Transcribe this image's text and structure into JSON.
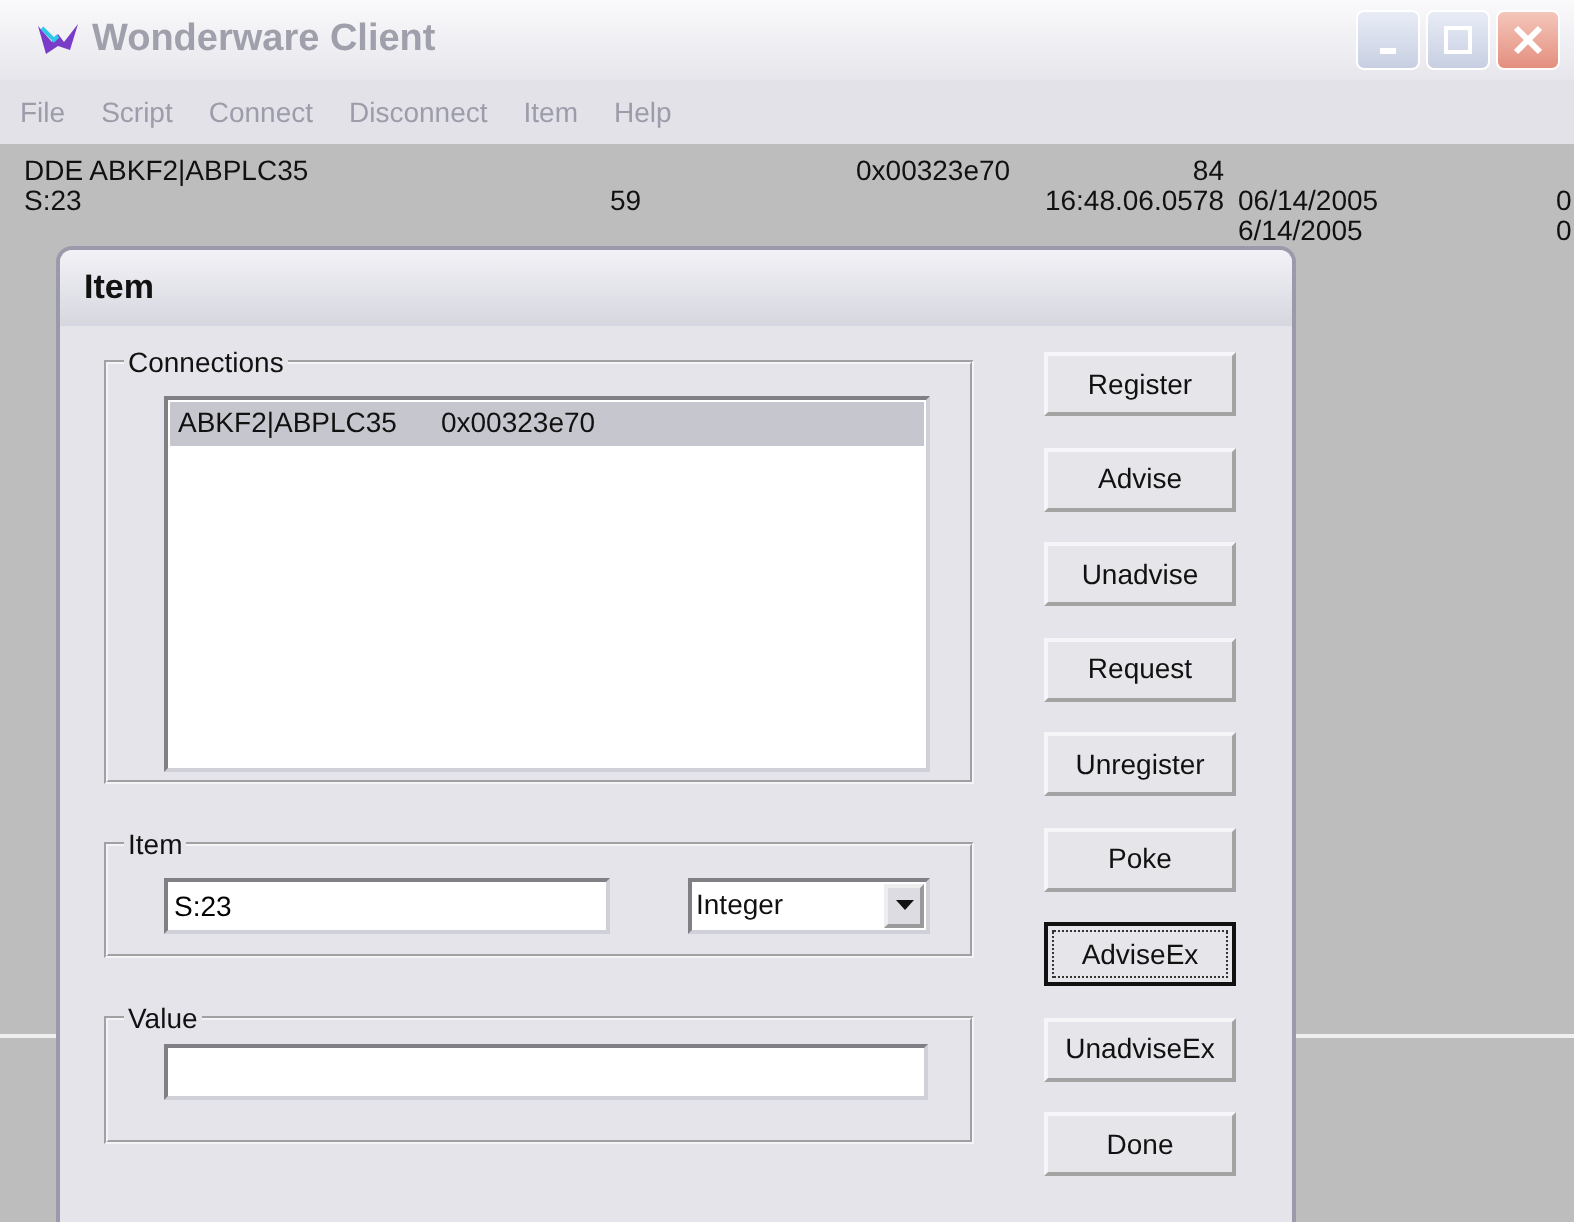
{
  "window": {
    "title": "Wonderware Client",
    "active": false
  },
  "menu": [
    {
      "label": "File",
      "disabled": true
    },
    {
      "label": "Script",
      "disabled": true
    },
    {
      "label": "Connect",
      "disabled": true
    },
    {
      "label": "Disconnect",
      "disabled": true
    },
    {
      "label": "Item",
      "disabled": true
    },
    {
      "label": "Help",
      "disabled": true
    }
  ],
  "log_rows": [
    {
      "column_1": "DDE  ABKF2|ABPLC35",
      "column_3": "0x00323e70",
      "column_4": "84"
    },
    {
      "column_1": "S:23",
      "column_2": "59",
      "column_4": "16:48.06.0578",
      "column_5": "06/14/2005",
      "column_6": "0"
    },
    {
      "column_5": "6/14/2005",
      "column_6": "0"
    }
  ],
  "dialog": {
    "title": "Item",
    "connections": {
      "label": "Connections",
      "items": [
        {
          "name": "ABKF2|ABPLC35",
          "handle": "0x00323e70",
          "selected": true
        }
      ]
    },
    "item": {
      "label": "Item",
      "value": "S:23",
      "type": "Integer"
    },
    "value": {
      "label": "Value"
    },
    "buttons": [
      {
        "label": "Register",
        "focused": false
      },
      {
        "label": "Advise",
        "focused": false
      },
      {
        "label": "Unadvise",
        "focused": false
      },
      {
        "label": "Request",
        "focused": false
      },
      {
        "label": "Unregister",
        "focused": false
      },
      {
        "label": "Poke",
        "focused": false
      },
      {
        "label": "AdviseEx",
        "focused": true
      },
      {
        "label": "UnadviseEx",
        "focused": false
      },
      {
        "label": "Done",
        "focused": false
      }
    ]
  }
}
